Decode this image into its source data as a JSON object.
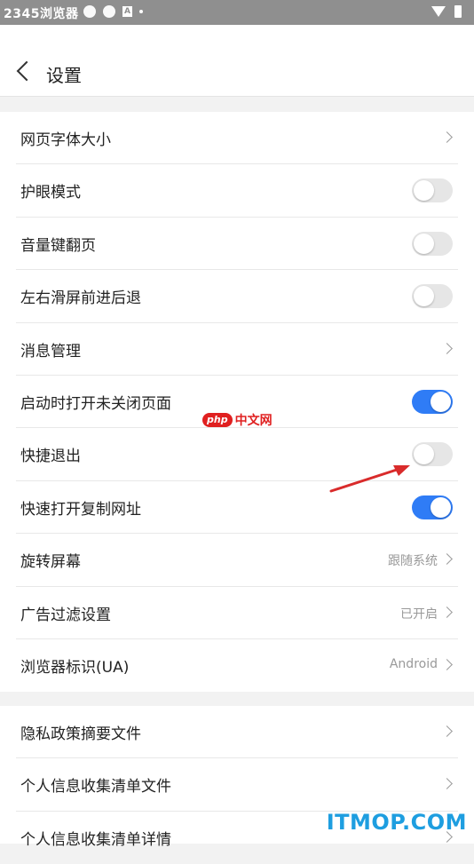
{
  "status_bar": {
    "time": "2345浏览器",
    "mini_label": "A"
  },
  "header": {
    "title": "设置"
  },
  "settings_group1": [
    {
      "label": "网页字体大小",
      "type": "chevron"
    },
    {
      "label": "护眼模式",
      "type": "toggle",
      "on": false
    },
    {
      "label": "音量键翻页",
      "type": "toggle",
      "on": false
    },
    {
      "label": "左右滑屏前进后退",
      "type": "toggle",
      "on": false
    },
    {
      "label": "消息管理",
      "type": "chevron"
    },
    {
      "label": "启动时打开未关闭页面",
      "type": "toggle",
      "on": true
    },
    {
      "label": "快捷退出",
      "type": "toggle",
      "on": false
    },
    {
      "label": "快速打开复制网址",
      "type": "toggle",
      "on": true
    },
    {
      "label": "旋转屏幕",
      "type": "chevron",
      "value": "跟随系统"
    },
    {
      "label": "广告过滤设置",
      "type": "chevron",
      "value": "已开启"
    },
    {
      "label": "浏览器标识(UA)",
      "type": "chevron",
      "value": "Android"
    }
  ],
  "settings_group2": [
    {
      "label": "隐私政策摘要文件",
      "type": "chevron"
    },
    {
      "label": "个人信息收集清单文件",
      "type": "chevron"
    },
    {
      "label": "个人信息收集清单详情",
      "type": "chevron"
    }
  ],
  "watermarks": {
    "php_badge": "php",
    "php_text": "中文网",
    "site": "ITMOP.COM"
  },
  "colors": {
    "toggle_on": "#2f7cf6",
    "toggle_off": "#e6e6e6",
    "arrow": "#d92b2b"
  }
}
